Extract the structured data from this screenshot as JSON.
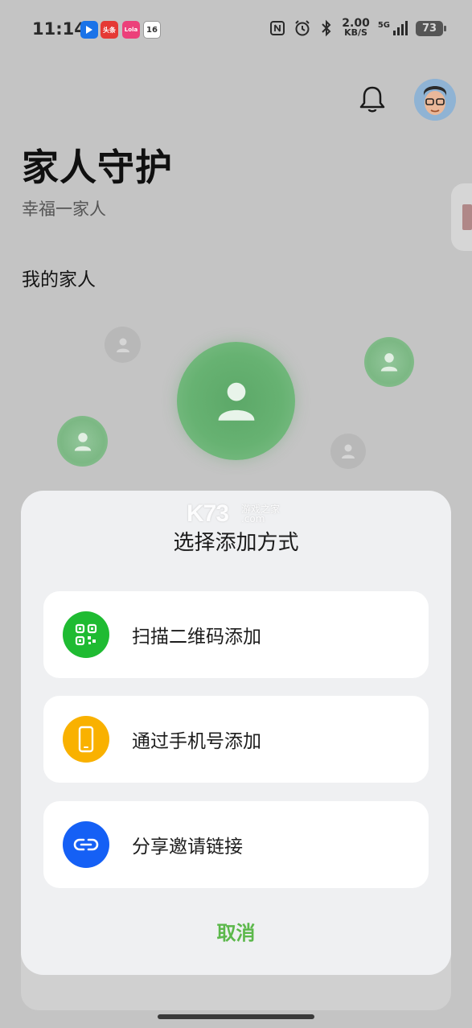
{
  "status_bar": {
    "time": "11:14",
    "app_badges": [
      "头条",
      "Lola",
      "16"
    ],
    "net_speed_value": "2.00",
    "net_speed_unit": "KB/S",
    "network": "5G",
    "battery": "73"
  },
  "header": {
    "title": "家人守护",
    "subtitle": "幸福一家人",
    "section": "我的家人"
  },
  "watermark": {
    "logo": "K73",
    "site_cn": "游戏之家",
    "domain": ".com"
  },
  "sheet": {
    "title": "选择添加方式",
    "options": [
      {
        "label": "扫描二维码添加",
        "icon": "qr-code-icon",
        "color": "#1fbb32"
      },
      {
        "label": "通过手机号添加",
        "icon": "phone-icon",
        "color": "#f9b100"
      },
      {
        "label": "分享邀请链接",
        "icon": "link-icon",
        "color": "#1560f5"
      }
    ],
    "cancel": "取消"
  },
  "colors": {
    "accent_green": "#5cb84b",
    "background_dim": "#c4c4c4",
    "sheet_bg": "#eff0f2"
  }
}
